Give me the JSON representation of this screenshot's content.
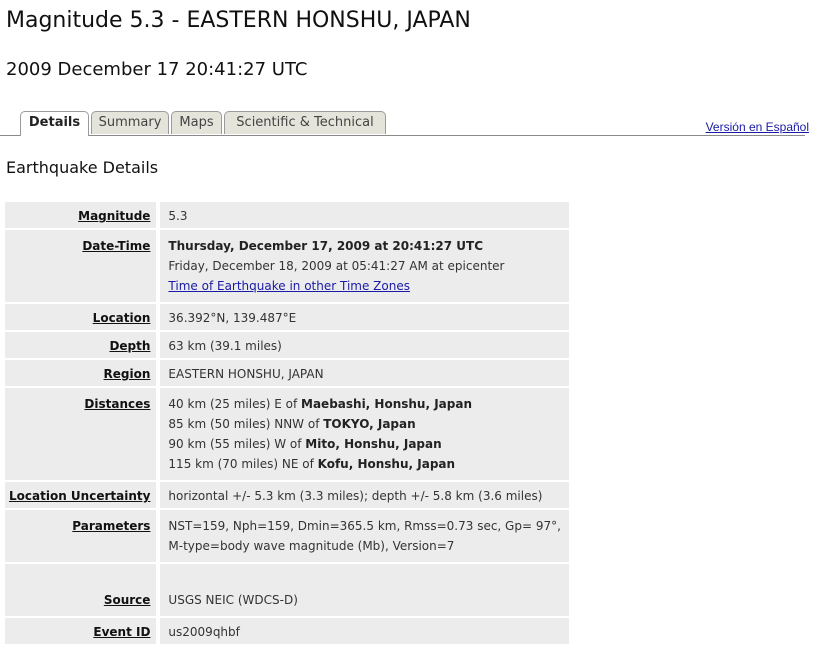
{
  "header": {
    "title": "Magnitude 5.3 - EASTERN HONSHU, JAPAN",
    "datetime": "2009 December 17 20:41:27 UTC"
  },
  "tabs": [
    {
      "label": "Details",
      "active": true
    },
    {
      "label": "Summary",
      "active": false
    },
    {
      "label": "Maps",
      "active": false
    },
    {
      "label": "Scientific & Technical",
      "active": false
    }
  ],
  "language_link": "Versión en Español",
  "section_heading": "Earthquake Details",
  "details": {
    "magnitude": {
      "label": "Magnitude",
      "value": "5.3"
    },
    "datetime": {
      "label": "Date-Time",
      "utc": "Thursday, December 17, 2009 at 20:41:27 UTC",
      "local": "Friday, December 18, 2009 at 05:41:27 AM at epicenter",
      "link": "Time of Earthquake in other Time Zones"
    },
    "location": {
      "label": "Location",
      "value": "36.392°N, 139.487°E"
    },
    "depth": {
      "label": "Depth",
      "value": "63 km (39.1 miles)"
    },
    "region": {
      "label": "Region",
      "value": "EASTERN HONSHU, JAPAN"
    },
    "distances": {
      "label": "Distances",
      "items": [
        {
          "dist": "40 km (25 miles) E of",
          "place": "Maebashi, Honshu, Japan"
        },
        {
          "dist": "85 km (50 miles) NNW of",
          "place": "TOKYO, Japan"
        },
        {
          "dist": "90 km (55 miles) W of",
          "place": "Mito, Honshu, Japan"
        },
        {
          "dist": "115 km (70 miles) NE of",
          "place": "Kofu, Honshu, Japan"
        }
      ]
    },
    "uncertainty": {
      "label": "Location Uncertainty",
      "value": "horizontal +/- 5.3 km (3.3 miles); depth +/- 5.8 km (3.6 miles)"
    },
    "parameters": {
      "label": "Parameters",
      "line1": "NST=159, Nph=159, Dmin=365.5 km, Rmss=0.73 sec, Gp= 97°,",
      "line2": "M-type=body wave magnitude (Mb), Version=7"
    },
    "source": {
      "label": "Source",
      "value": "USGS NEIC (WDCS-D)"
    },
    "event_id": {
      "label": "Event ID",
      "value": "us2009qhbf"
    }
  }
}
